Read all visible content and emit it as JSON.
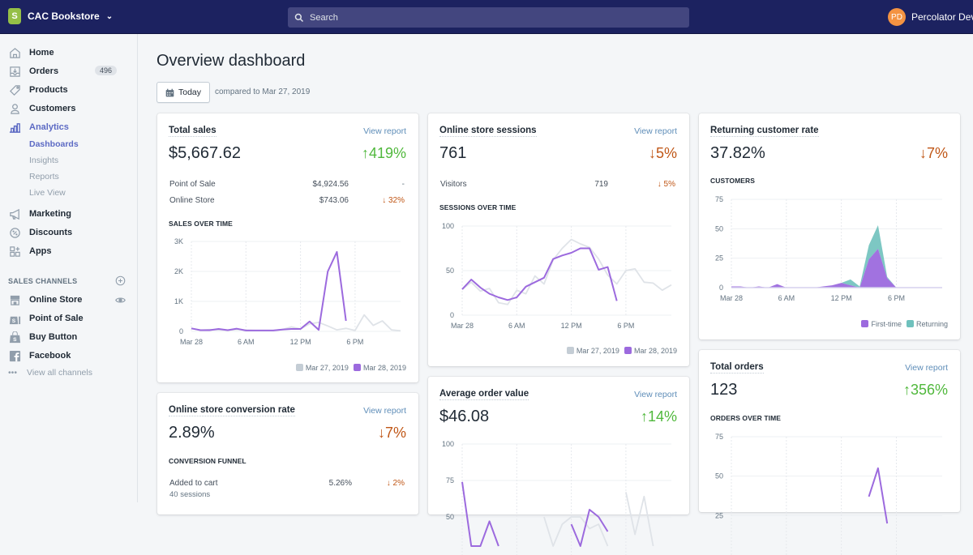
{
  "topbar": {
    "store_name": "CAC Bookstore",
    "store_logo_letter": "S",
    "search_placeholder": "Search",
    "user_initials": "PD",
    "user_name": "Percolator Devs"
  },
  "sidebar": {
    "items": [
      {
        "label": "Home",
        "icon": "home-icon"
      },
      {
        "label": "Orders",
        "icon": "orders-icon",
        "badge": "496"
      },
      {
        "label": "Products",
        "icon": "tag-icon"
      },
      {
        "label": "Customers",
        "icon": "person-icon"
      },
      {
        "label": "Analytics",
        "icon": "bar-chart-icon",
        "active": true
      },
      {
        "label": "Marketing",
        "icon": "megaphone-icon"
      },
      {
        "label": "Discounts",
        "icon": "discount-icon"
      },
      {
        "label": "Apps",
        "icon": "apps-icon"
      }
    ],
    "analytics_subitems": [
      {
        "label": "Dashboards",
        "active": true
      },
      {
        "label": "Insights"
      },
      {
        "label": "Reports"
      },
      {
        "label": "Live View"
      }
    ],
    "sales_channels_title": "SALES CHANNELS",
    "channels": [
      {
        "label": "Online Store",
        "icon": "online-store-icon"
      },
      {
        "label": "Point of Sale",
        "icon": "pos-bag-icon"
      },
      {
        "label": "Buy Button",
        "icon": "buy-button-bag-icon"
      },
      {
        "label": "Facebook",
        "icon": "facebook-icon"
      }
    ],
    "view_all": "View all channels",
    "view_all_icon": "•••"
  },
  "page": {
    "title": "Overview dashboard",
    "date_button": "Today",
    "compared": "compared to Mar 27, 2019"
  },
  "colors": {
    "current": "#9c6ade",
    "previous": "#dfe3e8",
    "returning": "#6fc1bd",
    "up": "#50b83c",
    "down": "#c05717",
    "link": "#5e8db8"
  },
  "cards": {
    "total_sales": {
      "title": "Total sales",
      "link": "View report",
      "value": "$5,667.62",
      "change": "↑419%",
      "rows": [
        {
          "label": "Point of Sale",
          "value": "$4,924.56",
          "change": "-"
        },
        {
          "label": "Online Store",
          "value": "$743.06",
          "change": "↓ 32%"
        }
      ],
      "chart_title": "SALES OVER TIME",
      "legend": [
        "Mar 27, 2019",
        "Mar 28, 2019"
      ]
    },
    "sessions": {
      "title": "Online store sessions",
      "link": "View report",
      "value": "761",
      "change": "↓5%",
      "rows": [
        {
          "label": "Visitors",
          "value": "719",
          "change": "↓ 5%"
        }
      ],
      "chart_title": "SESSIONS OVER TIME",
      "legend": [
        "Mar 27, 2019",
        "Mar 28, 2019"
      ]
    },
    "returning": {
      "title": "Returning customer rate",
      "value": "37.82%",
      "change": "↓7%",
      "chart_title": "CUSTOMERS",
      "legend": [
        "First-time",
        "Returning"
      ]
    },
    "conversion": {
      "title": "Online store conversion rate",
      "link": "View report",
      "value": "2.89%",
      "change": "↓7%",
      "chart_title": "CONVERSION FUNNEL",
      "rows": [
        {
          "label": "Added to cart",
          "sub": "40 sessions",
          "value": "5.26%",
          "change": "↓ 2%"
        }
      ]
    },
    "aov": {
      "title": "Average order value",
      "link": "View report",
      "value": "$46.08",
      "change": "↑14%"
    },
    "orders": {
      "title": "Total orders",
      "link": "View report",
      "value": "123",
      "change": "↑356%",
      "chart_title": "ORDERS OVER TIME"
    }
  },
  "chart_data": [
    {
      "id": "sales",
      "type": "line",
      "title": "SALES OVER TIME",
      "x_ticks": [
        "Mar 28",
        "6 AM",
        "12 PM",
        "6 PM"
      ],
      "y_ticks": [
        "0",
        "1K",
        "2K",
        "3K"
      ],
      "y_tick_values": [
        0,
        1000,
        2000,
        3000
      ],
      "ylim": [
        0,
        3000
      ],
      "x_count": 24,
      "series": [
        {
          "name": "Mar 27, 2019",
          "values": [
            100,
            40,
            60,
            50,
            40,
            60,
            40,
            30,
            30,
            30,
            60,
            150,
            80,
            250,
            300,
            180,
            50,
            100,
            30,
            550,
            200,
            350,
            50,
            20
          ]
        },
        {
          "name": "Mar 28, 2019",
          "values": [
            100,
            40,
            40,
            80,
            40,
            90,
            30,
            30,
            30,
            30,
            60,
            80,
            80,
            330,
            50,
            2000,
            2650,
            350
          ]
        }
      ]
    },
    {
      "id": "sessions",
      "type": "line",
      "title": "SESSIONS OVER TIME",
      "x_ticks": [
        "Mar 28",
        "6 AM",
        "12 PM",
        "6 PM"
      ],
      "y_ticks": [
        "0",
        "50",
        "100"
      ],
      "y_tick_values": [
        0,
        50,
        100
      ],
      "ylim": [
        0,
        100
      ],
      "x_count": 24,
      "series": [
        {
          "name": "Mar 27, 2019",
          "values": [
            29,
            37,
            27,
            30,
            14,
            12,
            28,
            24,
            44,
            35,
            62,
            75,
            85,
            80,
            76,
            63,
            45,
            35,
            50,
            52,
            37,
            36,
            28,
            34
          ]
        },
        {
          "name": "Mar 28, 2019",
          "values": [
            29,
            40,
            31,
            24,
            20,
            17,
            20,
            32,
            37,
            42,
            63,
            67,
            70,
            75,
            75,
            51,
            54,
            16
          ]
        }
      ]
    },
    {
      "id": "customers",
      "type": "area",
      "title": "CUSTOMERS",
      "x_ticks": [
        "Mar 28",
        "6 AM",
        "12 PM",
        "6 PM"
      ],
      "y_ticks": [
        "0",
        "25",
        "50",
        "75"
      ],
      "y_tick_values": [
        0,
        25,
        50,
        75
      ],
      "ylim": [
        0,
        75
      ],
      "x_count": 24,
      "series": [
        {
          "name": "First-time",
          "values": [
            1,
            1,
            0,
            1,
            0,
            3,
            0,
            0,
            0,
            0,
            1,
            2,
            4,
            2,
            0,
            24,
            33,
            8,
            0,
            0,
            0,
            0,
            0,
            0
          ]
        },
        {
          "name": "Returning",
          "values": [
            0,
            0,
            0,
            0,
            0,
            0,
            0,
            0,
            0,
            0,
            0,
            0,
            0,
            5,
            1,
            12,
            20,
            1,
            0,
            0,
            0,
            0,
            0,
            0
          ]
        }
      ]
    },
    {
      "id": "aov",
      "type": "line",
      "title": "Average order value",
      "x_ticks": [],
      "y_ticks": [
        "50",
        "75",
        "100"
      ],
      "y_tick_values": [
        50,
        75,
        100
      ],
      "ylim": [
        0,
        100
      ],
      "x_count": 24,
      "series": [
        {
          "name": "Mar 27, 2019",
          "values": [
            null,
            null,
            null,
            null,
            null,
            null,
            null,
            null,
            null,
            50,
            30,
            45,
            50,
            50,
            42,
            45,
            30,
            null,
            67,
            38,
            64,
            30,
            null,
            null
          ]
        },
        {
          "name": "Mar 28, 2019",
          "values": [
            74,
            30,
            30,
            47,
            30,
            null,
            null,
            null,
            null,
            null,
            null,
            null,
            45,
            30,
            55,
            50,
            40,
            null
          ]
        }
      ]
    },
    {
      "id": "orders",
      "type": "line",
      "title": "ORDERS OVER TIME",
      "x_ticks": [],
      "y_ticks": [
        "25",
        "50",
        "75"
      ],
      "y_tick_values": [
        25,
        50,
        75
      ],
      "ylim": [
        0,
        75
      ],
      "x_count": 24,
      "series": [
        {
          "name": "Mar 28, 2019",
          "values": [
            null,
            null,
            null,
            null,
            null,
            null,
            null,
            null,
            null,
            null,
            null,
            null,
            null,
            null,
            null,
            37,
            55,
            20
          ]
        }
      ]
    }
  ]
}
